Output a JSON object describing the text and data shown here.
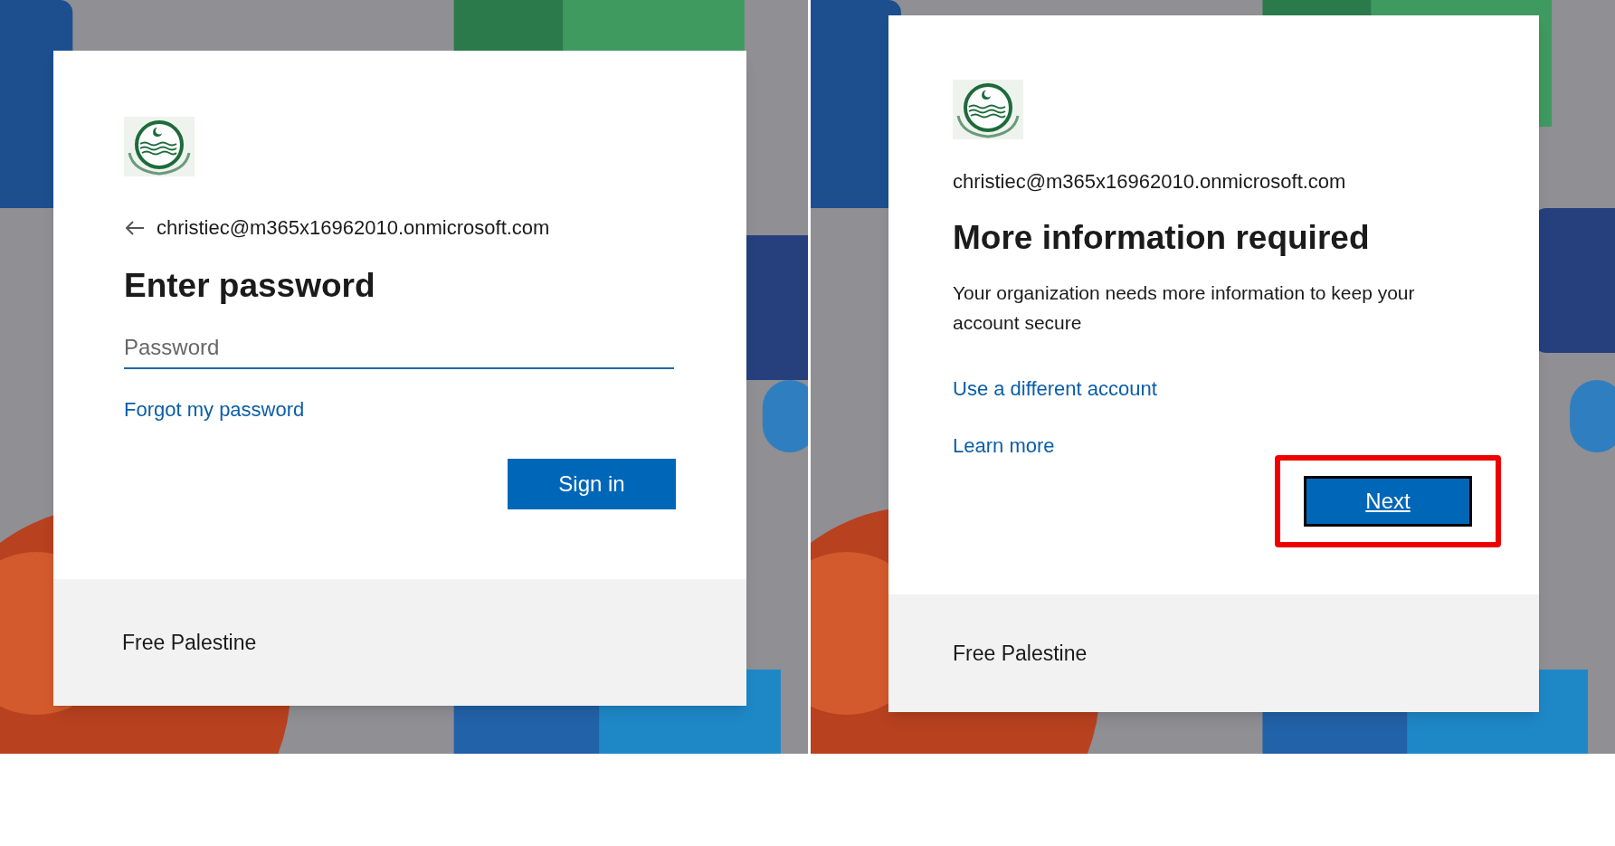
{
  "panels": [
    {
      "kind": "password",
      "email": "christiec@m365x16962010.onmicrosoft.com",
      "title": "Enter password",
      "field": {
        "placeholder": "Password"
      },
      "links": [
        "Forgot my password"
      ],
      "button": {
        "label": "Sign in",
        "focused": false,
        "highlighted": false
      },
      "footer": "Free Palestine"
    },
    {
      "kind": "info",
      "email": "christiec@m365x16962010.onmicrosoft.com",
      "title": "More information required",
      "message": "Your organization needs more information to keep your account secure",
      "links": [
        "Use a different account",
        "Learn more"
      ],
      "button": {
        "label": "Next",
        "focused": true,
        "highlighted": true
      },
      "footer": "Free Palestine"
    }
  ]
}
